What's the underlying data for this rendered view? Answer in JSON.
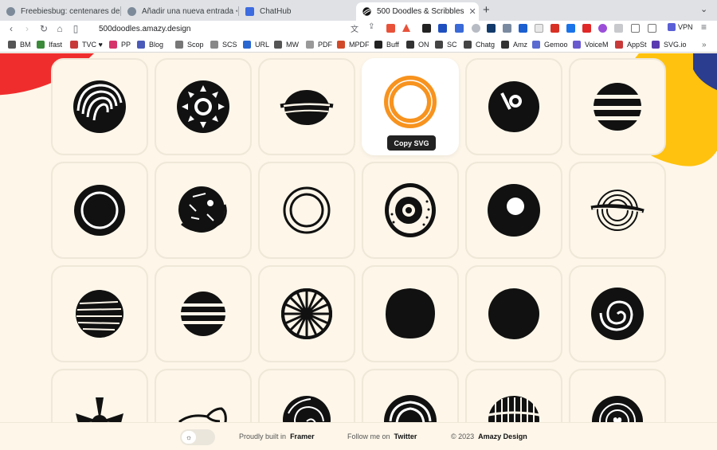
{
  "tabs": [
    {
      "title": "Freebiesbug: centenares de recursos",
      "favicon_color": "#7c8a99"
    },
    {
      "title": "Añadir una nueva entrada < Soft &",
      "favicon_color": "#7c8a99"
    },
    {
      "title": "ChatHub",
      "favicon_color": "#3d6be0"
    },
    {
      "title": "500 Doodles & Scribbles",
      "favicon_color": "#111111",
      "close": "✕"
    }
  ],
  "toolbar": {
    "url": "500doodles.amazy.design",
    "vpn_label": "VPN",
    "shield_badge": "9"
  },
  "bookmarks": [
    {
      "label": "BM",
      "color": "#555555"
    },
    {
      "label": "Ifast",
      "color": "#3a8a3a"
    },
    {
      "label": "TVC ♥",
      "color": "#c83a3a"
    },
    {
      "label": "PP",
      "color": "#d6336c"
    },
    {
      "label": "Blog",
      "color": "#4a5ab8"
    },
    {
      "label": "Scop",
      "color": "#777777"
    },
    {
      "label": "SCS",
      "color": "#888888"
    },
    {
      "label": "URL",
      "color": "#2a66d0"
    },
    {
      "label": "MW",
      "color": "#555555"
    },
    {
      "label": "PDF",
      "color": "#999999"
    },
    {
      "label": "MPDF",
      "color": "#d04a2a"
    },
    {
      "label": "Buff",
      "color": "#222222"
    },
    {
      "label": "ON",
      "color": "#333333"
    },
    {
      "label": "SC",
      "color": "#444444"
    },
    {
      "label": "Chatg",
      "color": "#444444"
    },
    {
      "label": "Amz",
      "color": "#333333"
    },
    {
      "label": "Gemoo",
      "color": "#5a6ad0"
    },
    {
      "label": "VoiceM",
      "color": "#6a5ad0"
    },
    {
      "label": "AppSt",
      "color": "#c83a3a"
    },
    {
      "label": "SVG.io",
      "color": "#5a3ab0"
    }
  ],
  "page": {
    "copy_button": "Copy SVG",
    "accent": "#f7931e",
    "doodles": [
      "doodle-wave-circle",
      "doodle-sun-circle",
      "doodle-saturn-stripe",
      "doodle-orange-ring",
      "doodle-eye-circle",
      "doodle-striped-ball",
      "doodle-target-circle",
      "doodle-cracked-ball",
      "doodle-double-ring",
      "doodle-dotted-eye",
      "doodle-donut",
      "doodle-ringed-planet",
      "doodle-lined-ball",
      "doodle-band-ball",
      "doodle-wheel",
      "doodle-solid-blob",
      "doodle-solid-circle",
      "doodle-spiral",
      "doodle-flower",
      "doodle-shoe",
      "doodle-scribble-spiral",
      "doodle-arc-circle",
      "doodle-hatched-oval",
      "doodle-heart-spiral"
    ]
  },
  "footer": {
    "built_prefix": "Proudly built in",
    "built_name": "Framer",
    "follow_prefix": "Follow me on",
    "follow_name": "Twitter",
    "copyright_prefix": "© 2023",
    "copyright_name": "Amazy Design",
    "theme_icon": "☼"
  }
}
